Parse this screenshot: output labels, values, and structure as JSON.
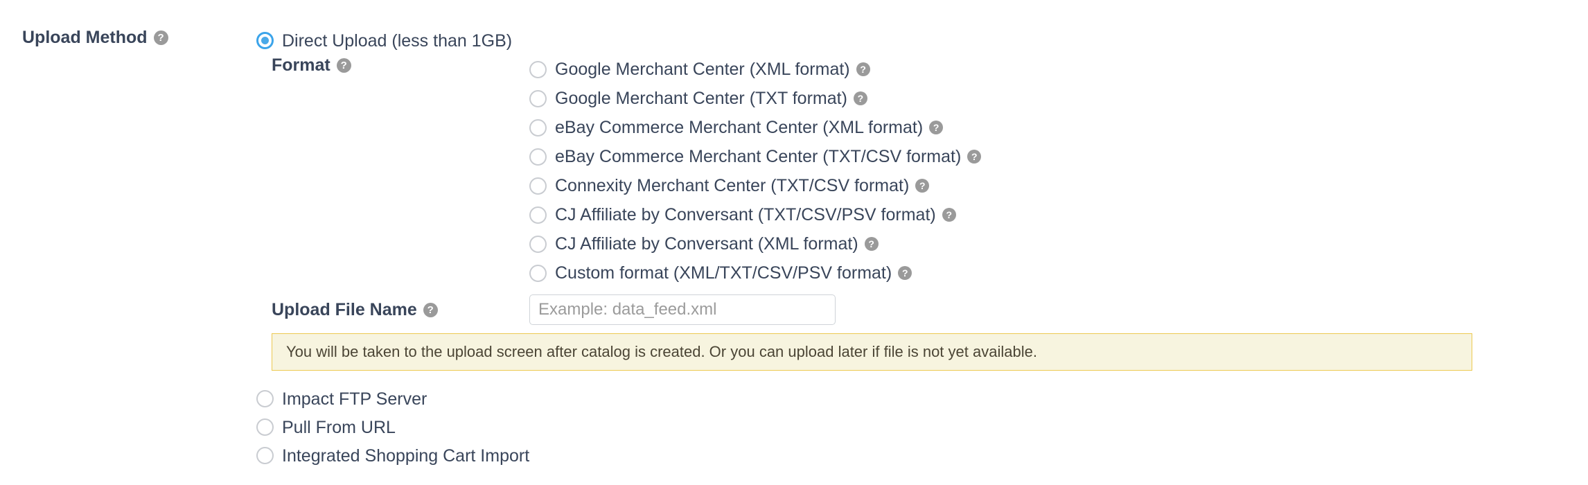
{
  "form": {
    "upload_method_label": "Upload Method",
    "help_glyph": "?",
    "methods": [
      {
        "label": "Direct Upload (less than 1GB)",
        "selected": true
      },
      {
        "label": "Impact FTP Server",
        "selected": false
      },
      {
        "label": "Pull From URL",
        "selected": false
      },
      {
        "label": "Integrated Shopping Cart Import",
        "selected": false
      }
    ],
    "format_section": {
      "label": "Format",
      "options": [
        {
          "label": "Google Merchant Center (XML format)",
          "selected": false,
          "has_help": true
        },
        {
          "label": "Google Merchant Center (TXT format)",
          "selected": false,
          "has_help": true
        },
        {
          "label": "eBay Commerce Merchant Center (XML format)",
          "selected": false,
          "has_help": true
        },
        {
          "label": "eBay Commerce Merchant Center (TXT/CSV format)",
          "selected": false,
          "has_help": true
        },
        {
          "label": "Connexity Merchant Center (TXT/CSV format)",
          "selected": false,
          "has_help": true
        },
        {
          "label": "CJ Affiliate by Conversant (TXT/CSV/PSV format)",
          "selected": false,
          "has_help": true
        },
        {
          "label": "CJ Affiliate by Conversant (XML format)",
          "selected": false,
          "has_help": true
        },
        {
          "label": "Custom format (XML/TXT/CSV/PSV format)",
          "selected": false,
          "has_help": true
        }
      ]
    },
    "upload_file_name": {
      "label": "Upload File Name",
      "placeholder": "Example: data_feed.xml",
      "value": ""
    },
    "notice": "You will be taken to the upload screen after catalog is created. Or you can upload later if file is not yet available."
  },
  "colors": {
    "accent": "#4aa9e8",
    "text": "#39455a",
    "notice_bg": "#f7f4df",
    "notice_border": "#edc951",
    "radio_border": "#c9ccd1",
    "help_bg": "#9a9a9a"
  }
}
